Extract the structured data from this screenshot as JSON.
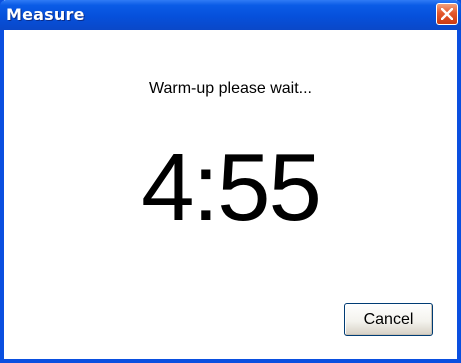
{
  "window": {
    "title": "Measure",
    "close_icon": "close-icon"
  },
  "dialog": {
    "message": "Warm-up please wait...",
    "countdown": "4:55",
    "cancel_label": "Cancel"
  },
  "colors": {
    "titlebar": "#0650db",
    "frame": "#0a4fe0",
    "close_button": "#e4582d",
    "background": "#ffffff",
    "text": "#000000"
  }
}
